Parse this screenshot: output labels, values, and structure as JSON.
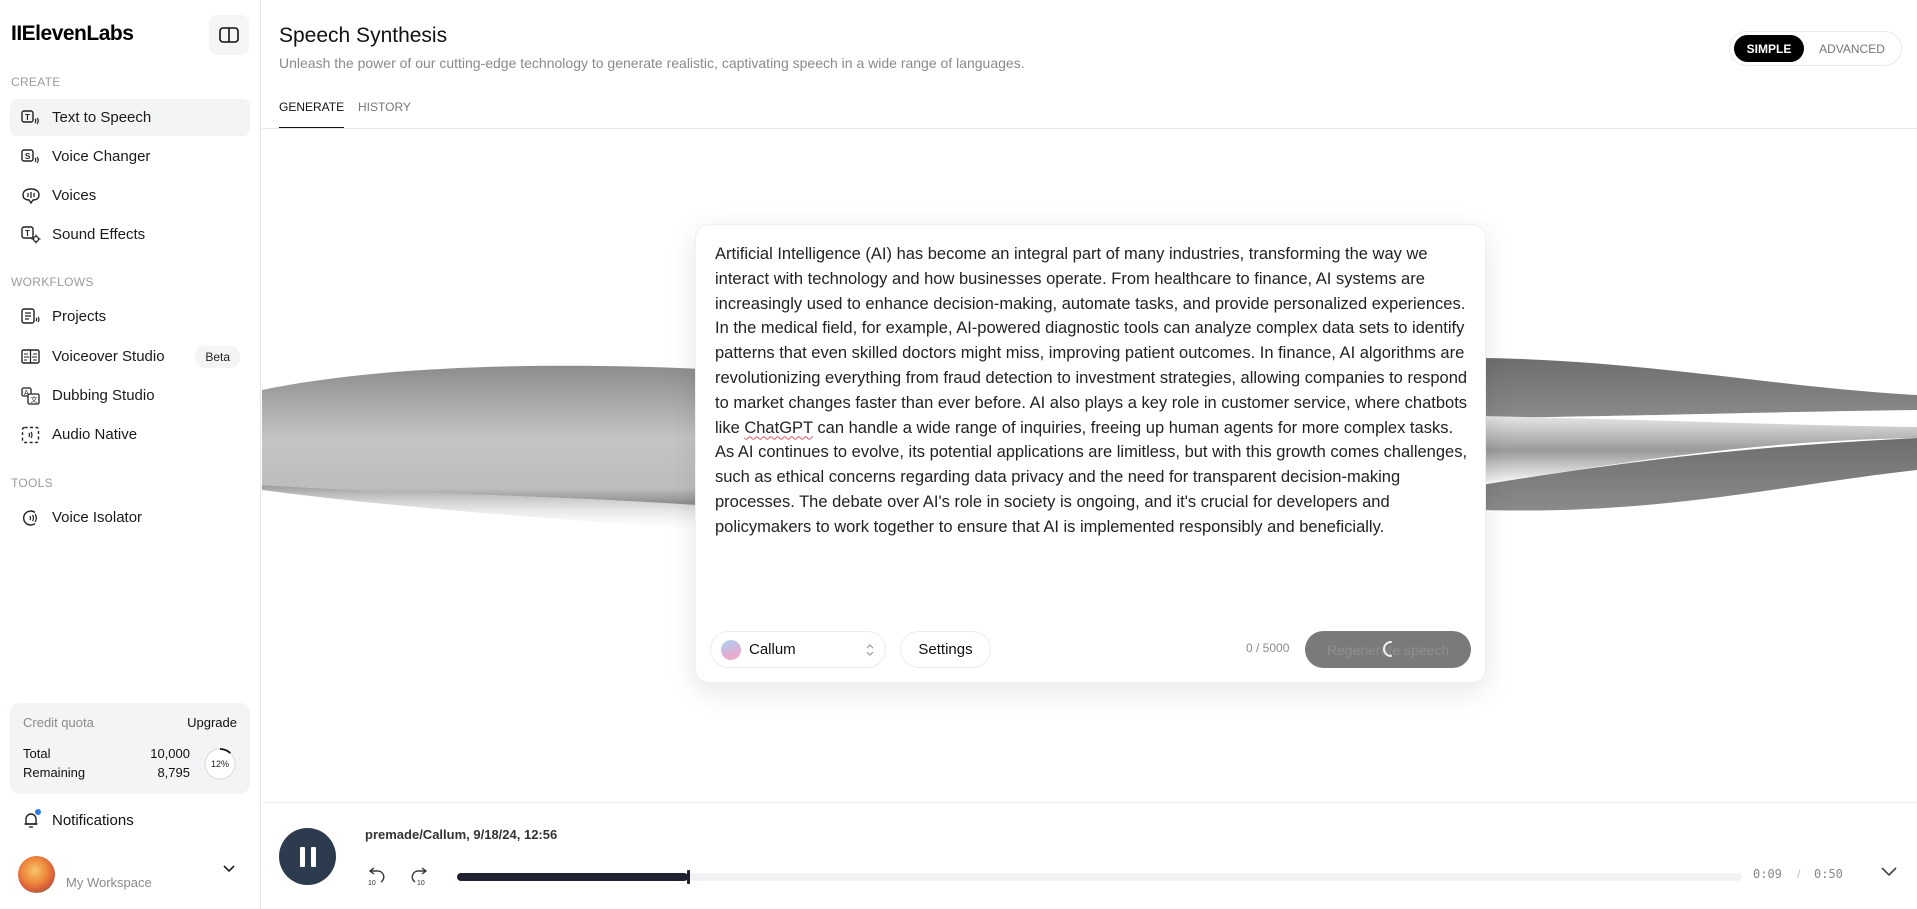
{
  "app": {
    "logo": "IIElevenLabs"
  },
  "sidebar": {
    "sections": [
      {
        "label": "CREATE"
      },
      {
        "label": "WORKFLOWS"
      },
      {
        "label": "TOOLS"
      }
    ],
    "items": [
      {
        "label": "Text to Speech",
        "icon": "text-to-speech-icon",
        "active": true
      },
      {
        "label": "Voice Changer",
        "icon": "voice-changer-icon"
      },
      {
        "label": "Voices",
        "icon": "voices-icon"
      },
      {
        "label": "Sound Effects",
        "icon": "sound-effects-icon"
      },
      {
        "label": "Projects",
        "icon": "projects-icon"
      },
      {
        "label": "Voiceover Studio",
        "icon": "voiceover-studio-icon",
        "badge": "Beta"
      },
      {
        "label": "Dubbing Studio",
        "icon": "dubbing-studio-icon"
      },
      {
        "label": "Audio Native",
        "icon": "audio-native-icon"
      },
      {
        "label": "Voice Isolator",
        "icon": "voice-isolator-icon"
      }
    ],
    "quota": {
      "title": "Credit quota",
      "upgrade": "Upgrade",
      "total_label": "Total",
      "total_value": "10,000",
      "remaining_label": "Remaining",
      "remaining_value": "8,795",
      "used_percent_label": "12%",
      "used_fraction": 0.12
    },
    "notifications": "Notifications",
    "workspace": "My Workspace"
  },
  "header": {
    "title": "Speech Synthesis",
    "subtitle": "Unleash the power of our cutting-edge technology to generate realistic, captivating speech in a wide range of languages.",
    "mode": {
      "simple": "SIMPLE",
      "advanced": "ADVANCED",
      "selected": "SIMPLE"
    },
    "tabs": [
      {
        "label": "GENERATE",
        "active": true
      },
      {
        "label": "HISTORY",
        "active": false
      }
    ]
  },
  "editor": {
    "text_before": "Artificial Intelligence (AI) has become an integral part of many industries, transforming the way we interact with technology and how businesses operate. From healthcare to finance, AI systems are increasingly used to enhance decision-making, automate tasks, and provide personalized experiences. In the medical field, for example, AI-powered diagnostic tools can analyze complex data sets to identify patterns that even skilled doctors might miss, improving patient outcomes. In finance, AI algorithms are revolutionizing everything from fraud detection to investment strategies, allowing companies to respond to market changes faster than ever before. AI also plays a key role in customer service, where chatbots like ",
    "text_misspelled": "ChatGPT",
    "text_after": " can handle a wide range of inquiries, freeing up human agents for more complex tasks. As AI continues to evolve, its potential applications are limitless, but with this growth comes challenges, such as ethical concerns regarding data privacy and the need for transparent decision-making processes. The debate over AI's role in society is ongoing, and it's crucial for developers and policymakers to work together to ensure that AI is implemented responsibly and beneficially.",
    "voice": "Callum",
    "settings": "Settings",
    "char_count": "0 / 5000",
    "generate_button": "Regenerate speech"
  },
  "player": {
    "title": "premade/Callum, 9/18/24, 12:56",
    "current_time": "0:09",
    "separator": "/",
    "total_time": "0:50",
    "progress_fraction": 0.18,
    "skip_back_label": "10",
    "skip_forward_label": "10"
  }
}
